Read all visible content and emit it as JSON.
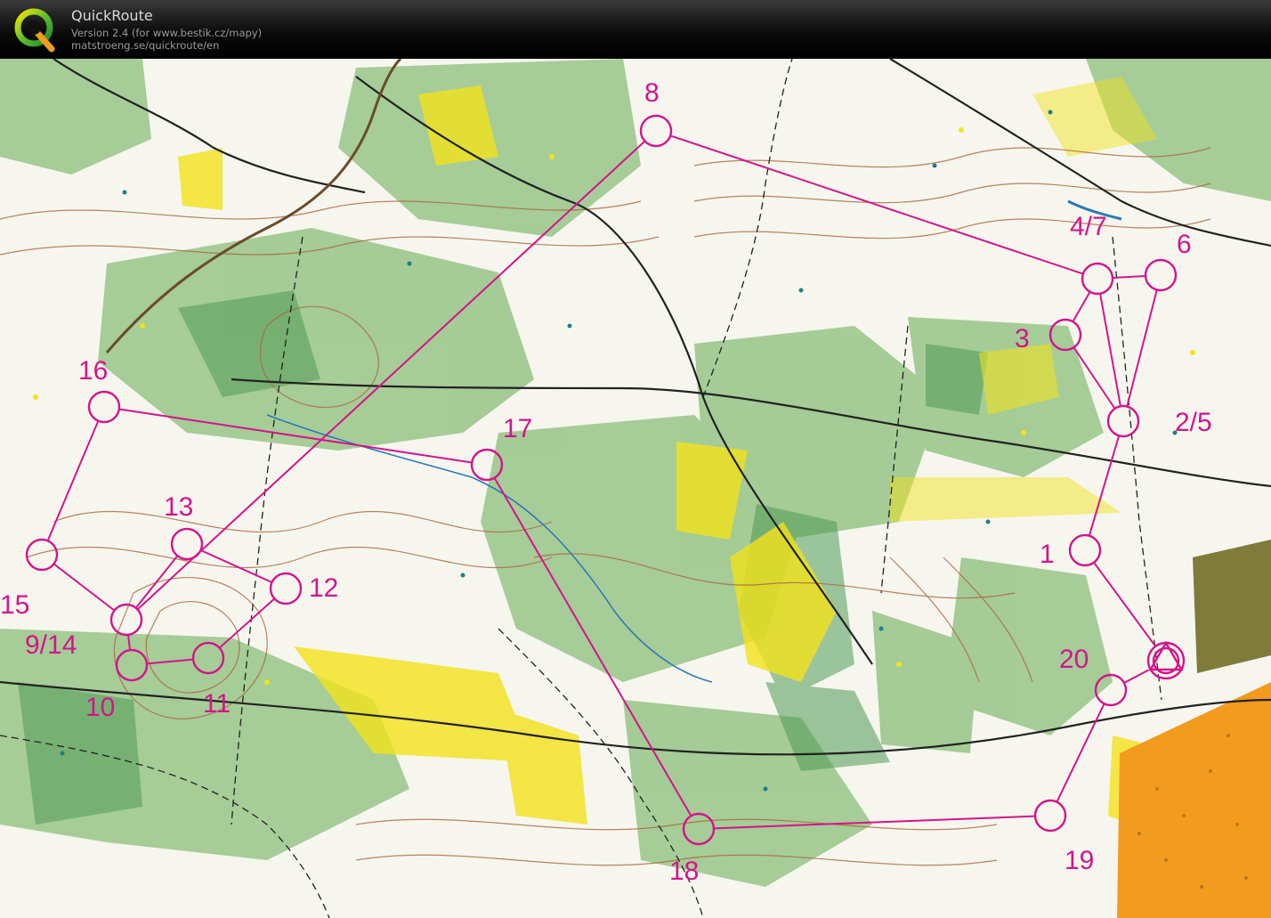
{
  "app": {
    "title": "QuickRoute",
    "version": "Version 2.4  (for www.bestik.cz/mapy)",
    "site": "matstroeng.se/quickroute/en",
    "logo_icon": "quickroute-q-logo"
  },
  "colors": {
    "course": "#d4148c",
    "forest_green": "#8fbf7e",
    "dense_green": "#4f9a55",
    "open_yellow": "#f2e21a",
    "contour_brown": "#a8663c",
    "orange_area": "#f29b1e"
  },
  "course": {
    "controls": [
      {
        "id": "c1",
        "label": "1"
      },
      {
        "id": "c2_5",
        "label": "2/5"
      },
      {
        "id": "c3",
        "label": "3"
      },
      {
        "id": "c4_7",
        "label": "4/7"
      },
      {
        "id": "c6",
        "label": "6"
      },
      {
        "id": "c8",
        "label": "8"
      },
      {
        "id": "c9_14",
        "label": "9/14"
      },
      {
        "id": "c10",
        "label": "10"
      },
      {
        "id": "c11",
        "label": "11"
      },
      {
        "id": "c12",
        "label": "12"
      },
      {
        "id": "c13",
        "label": "13"
      },
      {
        "id": "c15",
        "label": "15"
      },
      {
        "id": "c16",
        "label": "16"
      },
      {
        "id": "c17",
        "label": "17"
      },
      {
        "id": "c18",
        "label": "18"
      },
      {
        "id": "c19",
        "label": "19"
      },
      {
        "id": "c20",
        "label": "20"
      }
    ],
    "legs": [
      [
        "start",
        "c1"
      ],
      [
        "c1",
        "c2_5"
      ],
      [
        "c2_5",
        "c3"
      ],
      [
        "c3",
        "c4_7"
      ],
      [
        "c4_7",
        "c2_5"
      ],
      [
        "c2_5",
        "c6"
      ],
      [
        "c6",
        "c4_7"
      ],
      [
        "c4_7",
        "c8"
      ],
      [
        "c8",
        "c9_14"
      ],
      [
        "c9_14",
        "c10"
      ],
      [
        "c10",
        "c11"
      ],
      [
        "c11",
        "c12"
      ],
      [
        "c12",
        "c13"
      ],
      [
        "c13",
        "c9_14"
      ],
      [
        "c9_14",
        "c15"
      ],
      [
        "c15",
        "c16"
      ],
      [
        "c16",
        "c17"
      ],
      [
        "c17",
        "c18"
      ],
      [
        "c18",
        "c19"
      ],
      [
        "c19",
        "c20"
      ],
      [
        "c20",
        "finish"
      ]
    ]
  }
}
